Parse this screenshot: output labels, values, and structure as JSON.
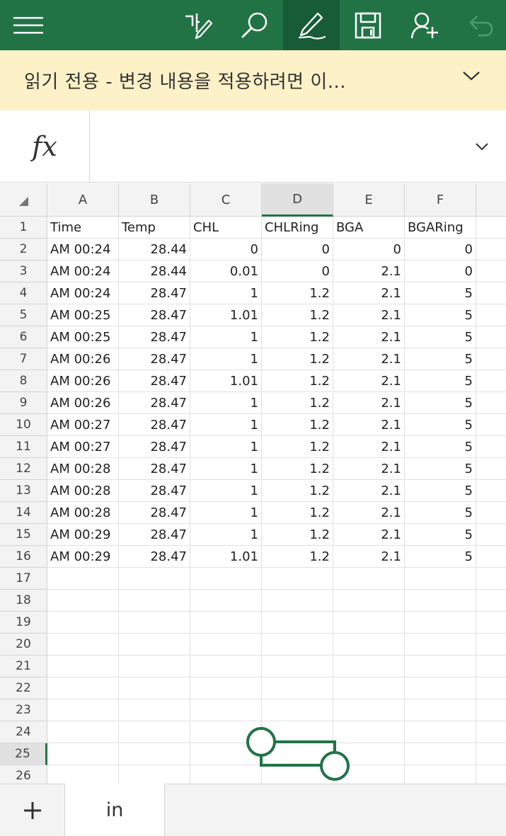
{
  "toolbar": {
    "buttons": [
      {
        "name": "menu",
        "icon": "hamburger-menu-icon"
      },
      {
        "name": "handwriting",
        "icon": "handwriting-pen-icon"
      },
      {
        "name": "search",
        "icon": "search-icon"
      },
      {
        "name": "draw",
        "icon": "pen-draw-icon",
        "active": true
      },
      {
        "name": "save",
        "icon": "save-icon"
      },
      {
        "name": "share",
        "icon": "add-person-icon"
      },
      {
        "name": "undo",
        "icon": "undo-icon",
        "disabled": true
      }
    ],
    "accent": "#217346"
  },
  "banner": {
    "text": "읽기 전용 - 변경 내용을 적용하려면 이...",
    "background": "#fdf1c8"
  },
  "formula_bar": {
    "label": "fx",
    "value": ""
  },
  "sheet": {
    "columns": [
      "A",
      "B",
      "C",
      "D",
      "E",
      "F"
    ],
    "selected_column": "D",
    "selected_row": 25,
    "rows": [
      {
        "n": "1",
        "cells": [
          "Time",
          "Temp",
          "CHL",
          "CHLRing",
          "BGA",
          "BGARing"
        ]
      },
      {
        "n": "2",
        "cells": [
          "AM 00:24",
          "28.44",
          "0",
          "0",
          "0",
          "0"
        ]
      },
      {
        "n": "3",
        "cells": [
          "AM 00:24",
          "28.44",
          "0.01",
          "0",
          "2.1",
          "0"
        ]
      },
      {
        "n": "4",
        "cells": [
          "AM 00:24",
          "28.47",
          "1",
          "1.2",
          "2.1",
          "5"
        ]
      },
      {
        "n": "5",
        "cells": [
          "AM 00:25",
          "28.47",
          "1.01",
          "1.2",
          "2.1",
          "5"
        ]
      },
      {
        "n": "6",
        "cells": [
          "AM 00:25",
          "28.47",
          "1",
          "1.2",
          "2.1",
          "5"
        ]
      },
      {
        "n": "7",
        "cells": [
          "AM 00:26",
          "28.47",
          "1",
          "1.2",
          "2.1",
          "5"
        ]
      },
      {
        "n": "8",
        "cells": [
          "AM 00:26",
          "28.47",
          "1.01",
          "1.2",
          "2.1",
          "5"
        ]
      },
      {
        "n": "9",
        "cells": [
          "AM 00:26",
          "28.47",
          "1",
          "1.2",
          "2.1",
          "5"
        ]
      },
      {
        "n": "10",
        "cells": [
          "AM 00:27",
          "28.47",
          "1",
          "1.2",
          "2.1",
          "5"
        ]
      },
      {
        "n": "11",
        "cells": [
          "AM 00:27",
          "28.47",
          "1",
          "1.2",
          "2.1",
          "5"
        ]
      },
      {
        "n": "12",
        "cells": [
          "AM 00:28",
          "28.47",
          "1",
          "1.2",
          "2.1",
          "5"
        ]
      },
      {
        "n": "13",
        "cells": [
          "AM 00:28",
          "28.47",
          "1",
          "1.2",
          "2.1",
          "5"
        ]
      },
      {
        "n": "14",
        "cells": [
          "AM 00:28",
          "28.47",
          "1",
          "1.2",
          "2.1",
          "5"
        ]
      },
      {
        "n": "15",
        "cells": [
          "AM 00:29",
          "28.47",
          "1",
          "1.2",
          "2.1",
          "5"
        ]
      },
      {
        "n": "16",
        "cells": [
          "AM 00:29",
          "28.47",
          "1.01",
          "1.2",
          "2.1",
          "5"
        ]
      },
      {
        "n": "17",
        "cells": [
          "",
          "",
          "",
          "",
          "",
          ""
        ]
      },
      {
        "n": "18",
        "cells": [
          "",
          "",
          "",
          "",
          "",
          ""
        ]
      },
      {
        "n": "19",
        "cells": [
          "",
          "",
          "",
          "",
          "",
          ""
        ]
      },
      {
        "n": "20",
        "cells": [
          "",
          "",
          "",
          "",
          "",
          ""
        ]
      },
      {
        "n": "21",
        "cells": [
          "",
          "",
          "",
          "",
          "",
          ""
        ]
      },
      {
        "n": "22",
        "cells": [
          "",
          "",
          "",
          "",
          "",
          ""
        ]
      },
      {
        "n": "23",
        "cells": [
          "",
          "",
          "",
          "",
          "",
          ""
        ]
      },
      {
        "n": "24",
        "cells": [
          "",
          "",
          "",
          "",
          "",
          ""
        ]
      },
      {
        "n": "25",
        "cells": [
          "",
          "",
          "",
          "",
          "",
          ""
        ]
      },
      {
        "n": "26",
        "cells": [
          "",
          "",
          "",
          "",
          "",
          ""
        ]
      }
    ]
  },
  "tabs": {
    "add_icon": "plus-icon",
    "sheets": [
      {
        "label": "in",
        "active": true
      }
    ]
  }
}
